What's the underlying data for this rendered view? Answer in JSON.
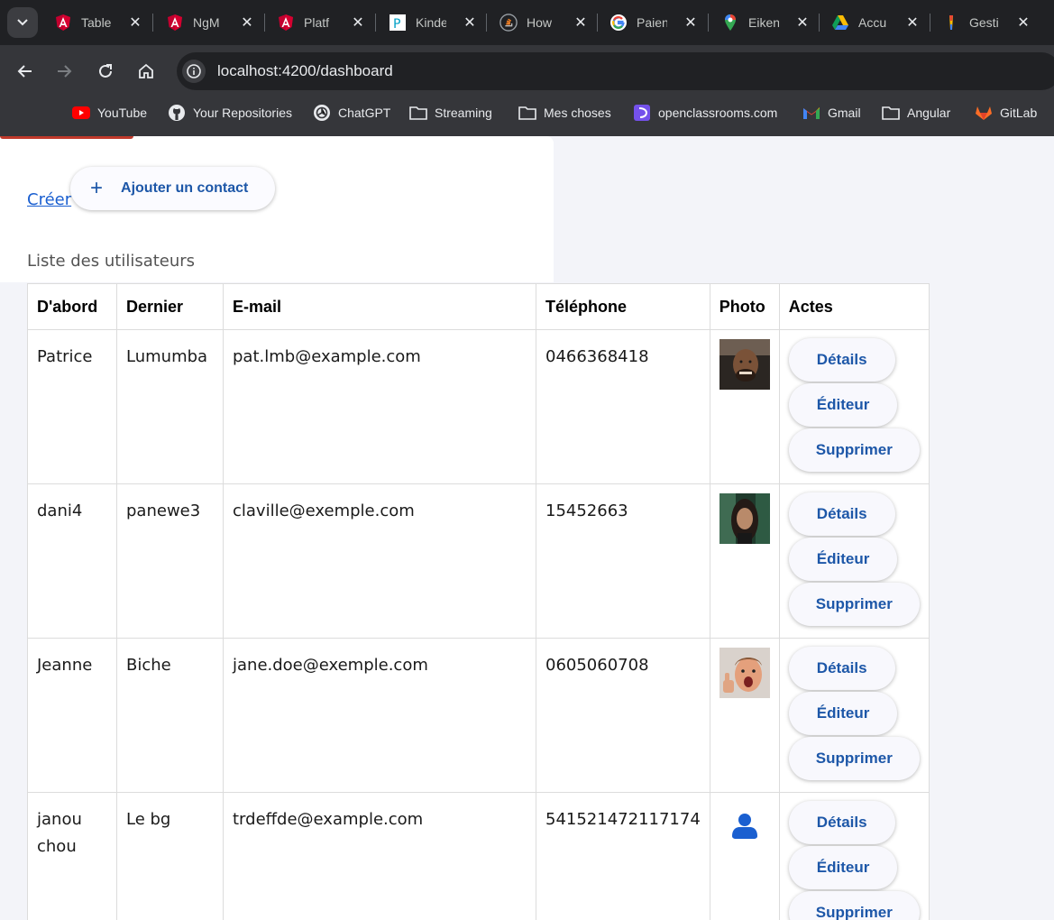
{
  "browser": {
    "tabs": [
      {
        "title": "Table",
        "icon": "angular-icon"
      },
      {
        "title": "NgM",
        "icon": "angular-icon"
      },
      {
        "title": "Platf",
        "icon": "angular-icon"
      },
      {
        "title": "Kinde",
        "icon": "kinde-icon"
      },
      {
        "title": "How",
        "icon": "stackoverflow-icon"
      },
      {
        "title": "Paien",
        "icon": "google-icon"
      },
      {
        "title": "Eiken",
        "icon": "maps-icon"
      },
      {
        "title": "Accu",
        "icon": "drive-icon"
      },
      {
        "title": "Gesti",
        "icon": "gemini-icon"
      }
    ],
    "url": "localhost:4200/dashboard",
    "bookmarks": [
      {
        "label": "YouTube",
        "icon": "youtube-icon"
      },
      {
        "label": "Your Repositories",
        "icon": "github-icon"
      },
      {
        "label": "ChatGPT",
        "icon": "chatgpt-icon"
      },
      {
        "label": "Streaming",
        "icon": "folder-icon"
      },
      {
        "label": "Mes choses",
        "icon": "folder-icon"
      },
      {
        "label": "openclassrooms.com",
        "icon": "openclassrooms-icon"
      },
      {
        "label": "Gmail",
        "icon": "gmail-icon"
      },
      {
        "label": "Angular",
        "icon": "folder-icon"
      },
      {
        "label": "GitLab",
        "icon": "gitlab-icon"
      }
    ]
  },
  "page": {
    "create_link": "Créer",
    "add_contact_label": "Ajouter un contact",
    "list_caption": "Liste des utilisateurs"
  },
  "table": {
    "headers": [
      "D'abord",
      "Dernier",
      "E-mail",
      "Téléphone",
      "Photo",
      "Actes"
    ],
    "rows": [
      {
        "first": "Patrice",
        "last": "Lumumba",
        "email": "pat.lmb@example.com",
        "phone": "0466368418",
        "photo": "photo-1"
      },
      {
        "first": "dani4",
        "last": "panewe3",
        "email": "claville@exemple.com",
        "phone": "15452663",
        "photo": "photo-2"
      },
      {
        "first": "Jeanne",
        "last": "Biche",
        "email": "jane.doe@exemple.com",
        "phone": "0605060708",
        "photo": "photo-3"
      },
      {
        "first": "janou chou",
        "last": "Le bg",
        "email": "trdeffde@example.com",
        "phone": "541521472117174",
        "photo": "default-avatar-icon"
      }
    ],
    "actions": {
      "details": "Détails",
      "edit": "Éditeur",
      "delete": "Supprimer"
    }
  },
  "colors": {
    "accent": "#1d57a8",
    "link": "#1a5fd0",
    "chrome_dark": "#202124",
    "chrome": "#35363a"
  }
}
